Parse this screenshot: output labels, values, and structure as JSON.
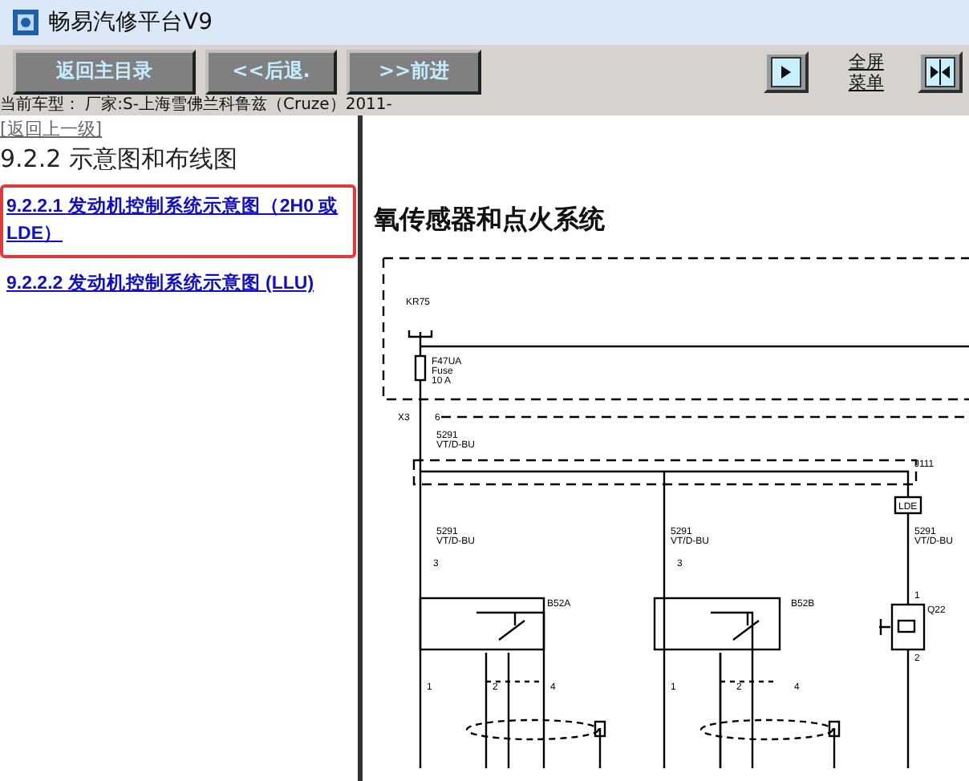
{
  "window": {
    "title": "畅易汽修平台V9"
  },
  "toolbar": {
    "buttons": [
      {
        "label": "返回主目录"
      },
      {
        "label": "<<后退."
      },
      {
        "label": ">>前进"
      }
    ],
    "fullscreen_link": "全屏菜单"
  },
  "vehicle_line": "当前车型： 厂家:S-上海雪佛兰科鲁兹（Cruze）2011-",
  "sidebar": {
    "back_link": "[返回上一级]",
    "heading": "9.2.2 示意图和布线图",
    "items": [
      {
        "label": "9.2.2.1 发动机控制系统示意图（2H0 或 LDE）",
        "selected": true
      },
      {
        "label": "9.2.2.2 发动机控制系统示意图 (LLU)",
        "selected": false
      }
    ]
  },
  "content": {
    "heading": "氧传感器和点火系统",
    "diagram": {
      "relay": "KR75",
      "fuse": {
        "name": "F47UA",
        "type": "Fuse",
        "rating": "10 A"
      },
      "connector": {
        "name": "X3",
        "pin": "6"
      },
      "wires": [
        {
          "circuit": "5291",
          "wire_code": "VT/D-BU"
        },
        {
          "circuit": "5291",
          "wire_code": "VT/D-BU"
        },
        {
          "circuit": "5291",
          "wire_code": "VT/D-BU"
        },
        {
          "circuit": "5291",
          "wire_code": "VT/D-BU"
        }
      ],
      "splice": "J111",
      "option": "LDE",
      "sensors": [
        {
          "name": "B52A",
          "pins": [
            "3",
            "1",
            "2",
            "4"
          ]
        },
        {
          "name": "B52B",
          "pins": [
            "3",
            "1",
            "2",
            "4"
          ]
        }
      ],
      "solenoid": {
        "name": "Q22",
        "pins": [
          "1",
          "2"
        ]
      }
    }
  }
}
